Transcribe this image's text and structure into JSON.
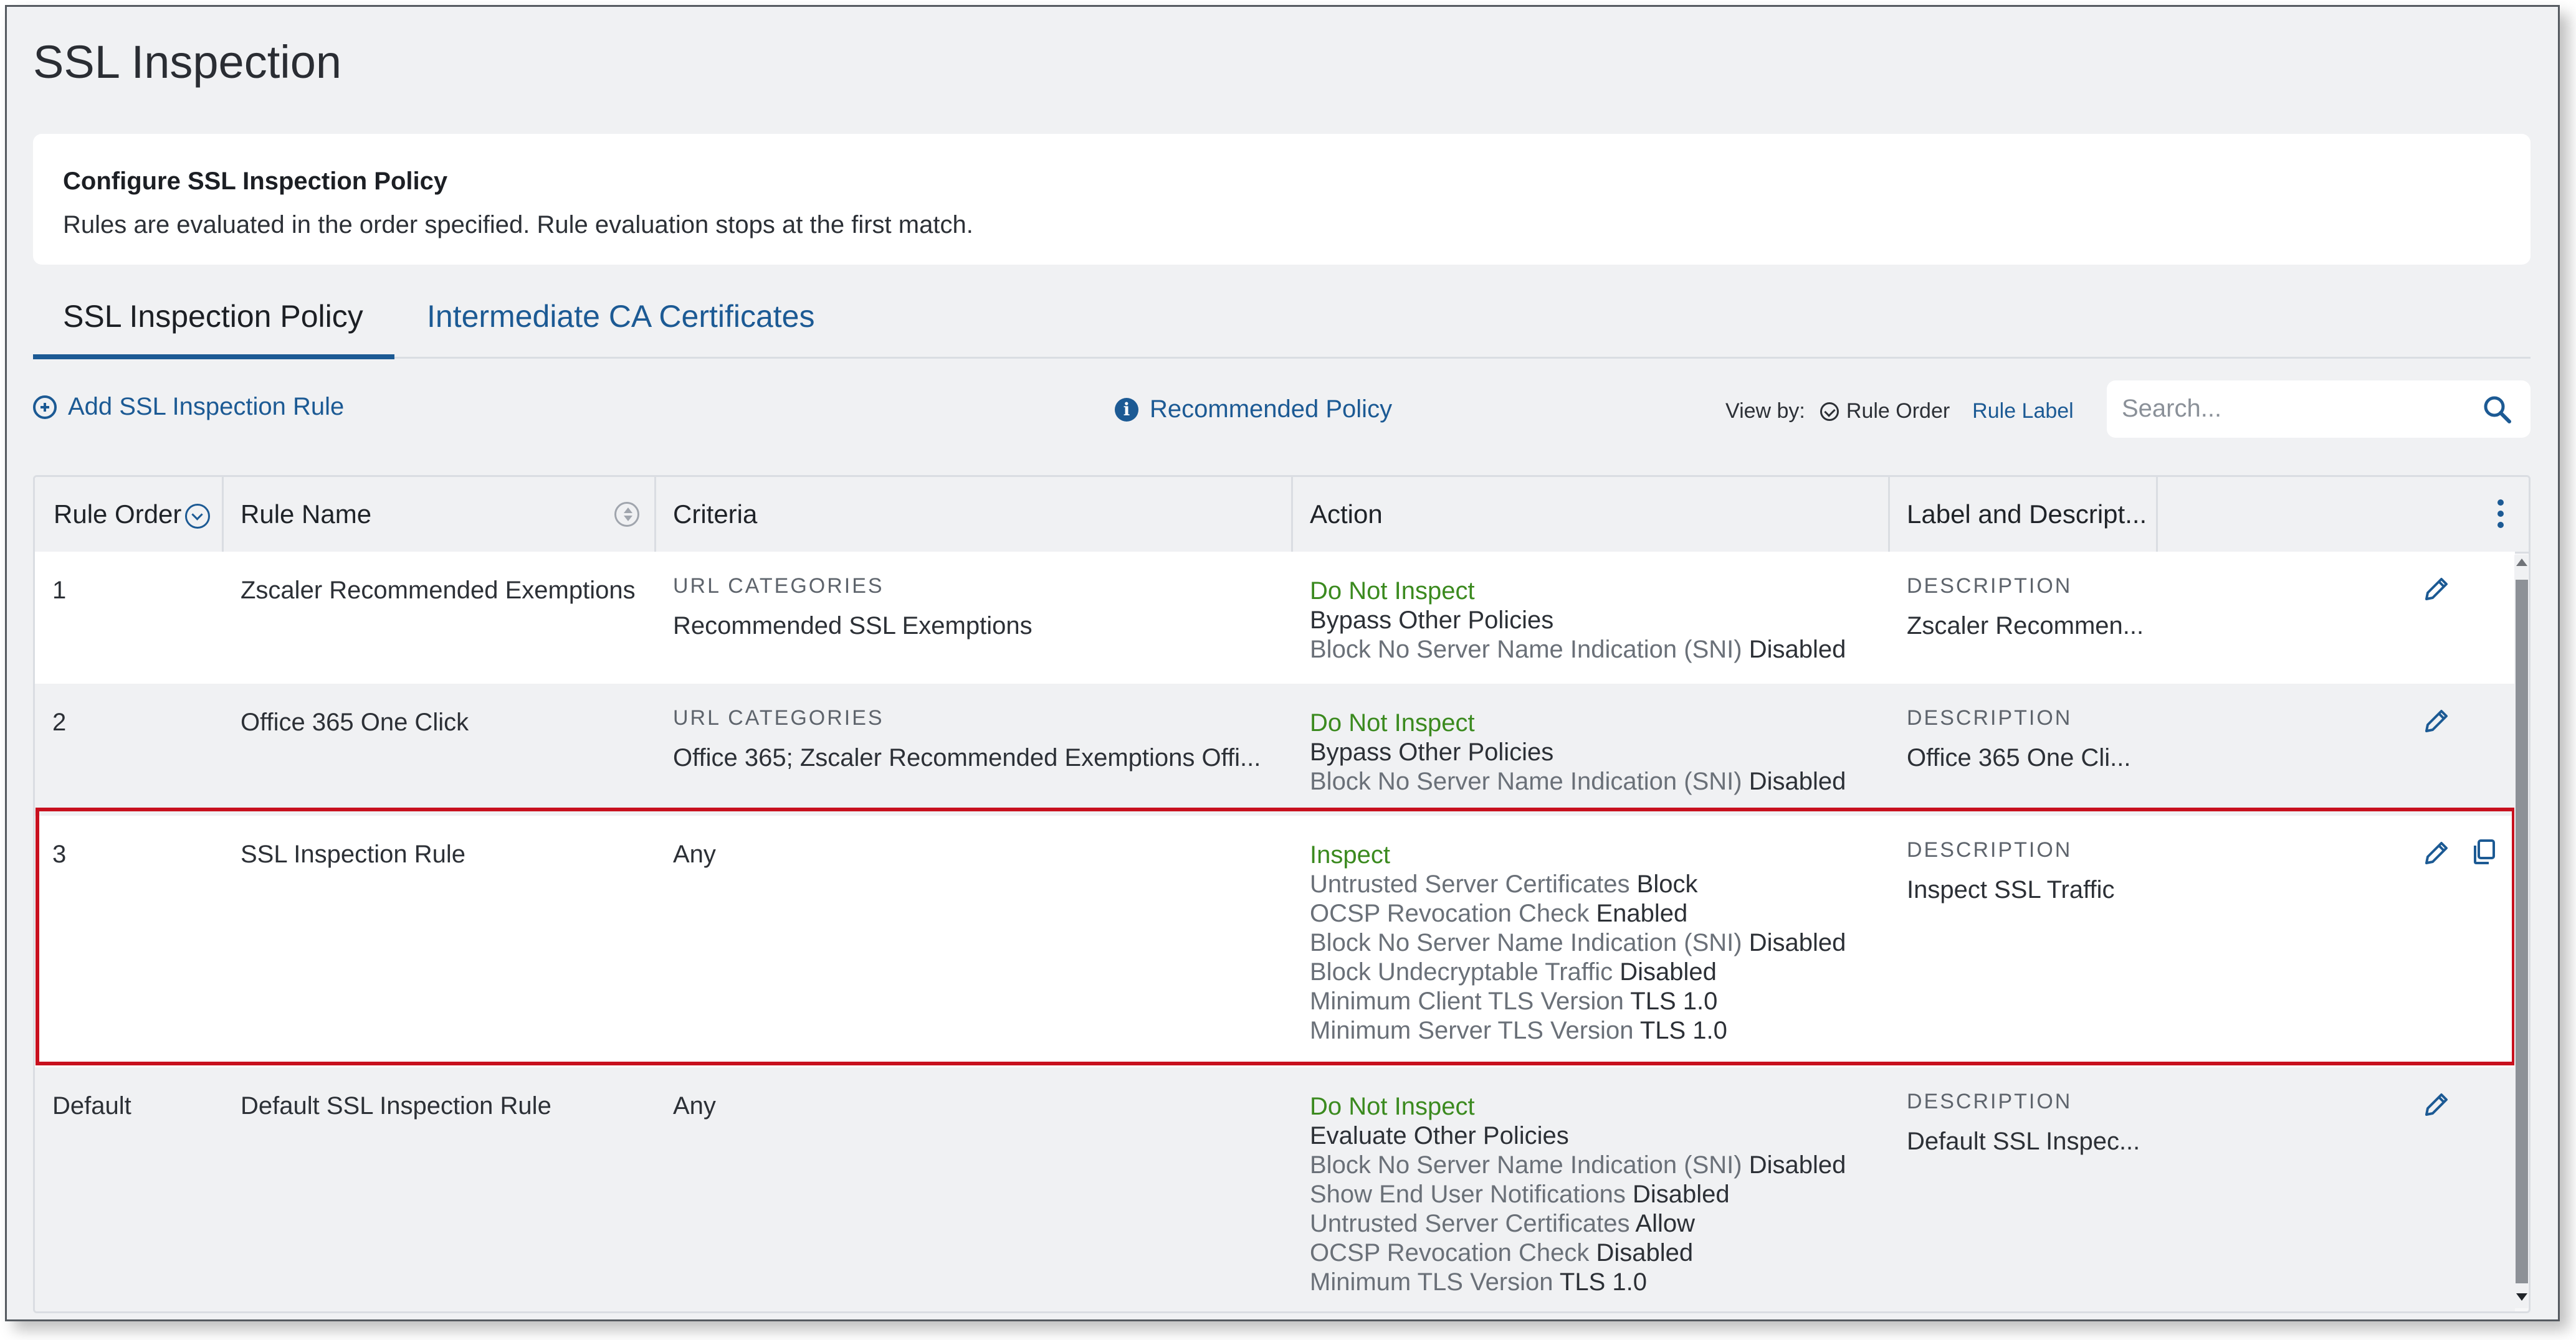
{
  "page": {
    "title": "SSL Inspection"
  },
  "info": {
    "title": "Configure SSL Inspection Policy",
    "text": "Rules are evaluated in the order specified. Rule evaluation stops at the first match."
  },
  "tabs": [
    {
      "label": "SSL Inspection Policy",
      "active": true
    },
    {
      "label": "Intermediate CA Certificates",
      "active": false
    }
  ],
  "toolbar": {
    "add_rule": "Add SSL Inspection Rule",
    "recommended": "Recommended Policy",
    "view_by": "View by:",
    "view_rule_order": "Rule Order",
    "view_rule_label": "Rule Label",
    "search_placeholder": "Search..."
  },
  "table": {
    "headers": {
      "order": "Rule Order",
      "name": "Rule Name",
      "criteria": "Criteria",
      "action": "Action",
      "label": "Label and Descript..."
    },
    "rows": [
      {
        "order": "1",
        "name": "Zscaler Recommended Exemptions",
        "criteria_cap": "URL CATEGORIES",
        "criteria": "Recommended SSL Exemptions",
        "action_main": "Do Not Inspect",
        "action_lines": [
          {
            "k": "Bypass Other Policies",
            "v": ""
          },
          {
            "k": "Block No Server Name Indication (SNI)",
            "v": "Disabled"
          }
        ],
        "label_cap": "DESCRIPTION",
        "label": "Zscaler Recommen..."
      },
      {
        "order": "2",
        "name": "Office 365 One Click",
        "criteria_cap": "URL CATEGORIES",
        "criteria": "Office 365; Zscaler Recommended Exemptions Offi...",
        "action_main": "Do Not Inspect",
        "action_lines": [
          {
            "k": "Bypass Other Policies",
            "v": ""
          },
          {
            "k": "Block No Server Name Indication (SNI)",
            "v": "Disabled"
          }
        ],
        "label_cap": "DESCRIPTION",
        "label": "Office 365 One Cli..."
      },
      {
        "order": "3",
        "name": "SSL Inspection Rule",
        "criteria_cap": "",
        "criteria": "Any",
        "action_main": "Inspect",
        "action_lines": [
          {
            "k": "Untrusted Server Certificates",
            "v": "Block"
          },
          {
            "k": "OCSP Revocation Check",
            "v": "Enabled"
          },
          {
            "k": "Block No Server Name Indication (SNI)",
            "v": "Disabled"
          },
          {
            "k": "Block Undecryptable Traffic",
            "v": "Disabled"
          },
          {
            "k": "Minimum Client TLS Version",
            "v": "TLS 1.0"
          },
          {
            "k": "Minimum Server TLS Version",
            "v": "TLS 1.0"
          }
        ],
        "label_cap": "DESCRIPTION",
        "label": "Inspect SSL Traffic"
      },
      {
        "order": "Default",
        "name": "Default SSL Inspection Rule",
        "criteria_cap": "",
        "criteria": "Any",
        "action_main": "Do Not Inspect",
        "action_lines": [
          {
            "k": "Evaluate Other Policies",
            "v": ""
          },
          {
            "k": "Block No Server Name Indication (SNI)",
            "v": "Disabled"
          },
          {
            "k": "Show End User Notifications",
            "v": "Disabled"
          },
          {
            "k": "Untrusted Server Certificates",
            "v": "Allow"
          },
          {
            "k": "OCSP Revocation Check",
            "v": "Disabled"
          },
          {
            "k": "Minimum TLS Version",
            "v": "TLS 1.0"
          }
        ],
        "label_cap": "DESCRIPTION",
        "label": "Default SSL Inspec..."
      }
    ]
  },
  "colors": {
    "accent": "#1c5a94",
    "action_green": "#3b8a1f",
    "highlight_red": "#c8101e"
  },
  "icons": [
    "plus-circle-icon",
    "info-icon",
    "check-circle-icon",
    "search-icon",
    "sort-icon",
    "kebab-menu-icon",
    "edit-pencil-icon",
    "copy-icon"
  ]
}
